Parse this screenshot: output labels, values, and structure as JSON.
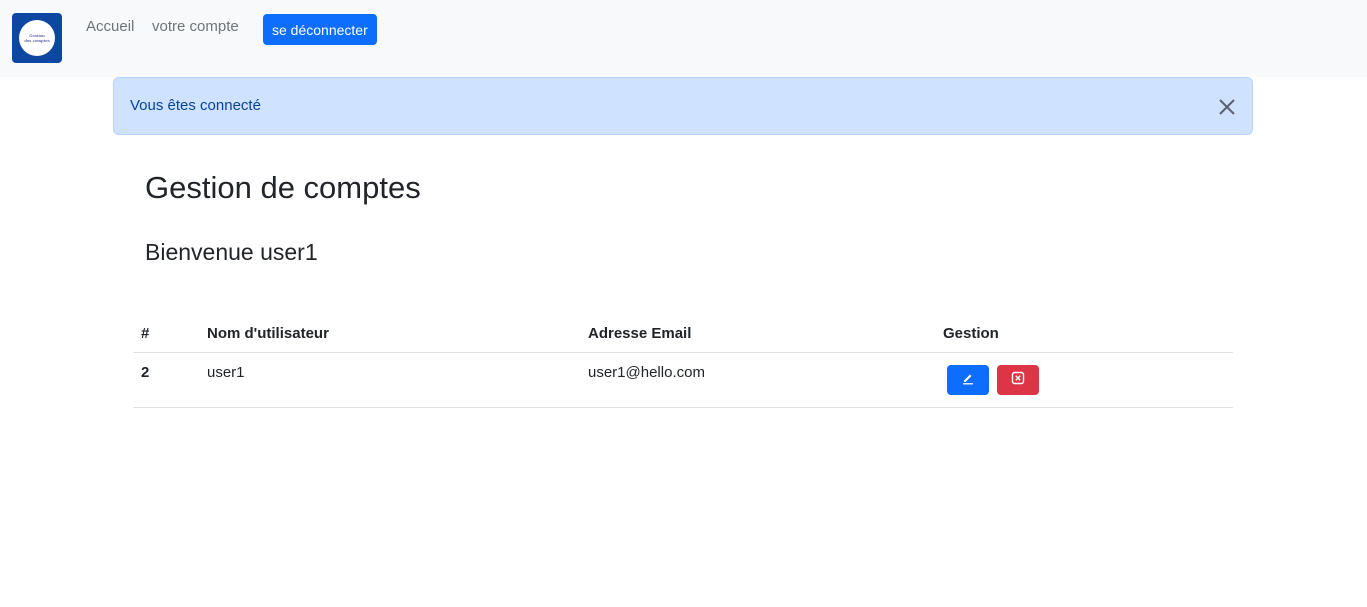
{
  "navbar": {
    "logo_text_line1": "Gestion",
    "logo_text_line2": "des comptes",
    "links": {
      "home": "Accueil",
      "account": "votre compte"
    },
    "logout_label": "se déconnecter"
  },
  "alert": {
    "message": "Vous êtes connecté"
  },
  "main": {
    "title": "Gestion de comptes",
    "welcome": "Bienvenue user1"
  },
  "table": {
    "headers": {
      "id": "#",
      "username": "Nom d'utilisateur",
      "email": "Adresse Email",
      "manage": "Gestion"
    },
    "rows": [
      {
        "id": "2",
        "username": "user1",
        "email": "user1@hello.com"
      }
    ]
  },
  "colors": {
    "primary": "#0d6efd",
    "danger": "#dc3545",
    "alert_bg": "#cfe2ff",
    "navbar_bg": "#f8f9fa"
  },
  "icons": {
    "edit": "pencil-icon",
    "delete": "x-square-icon",
    "close": "close-icon"
  }
}
